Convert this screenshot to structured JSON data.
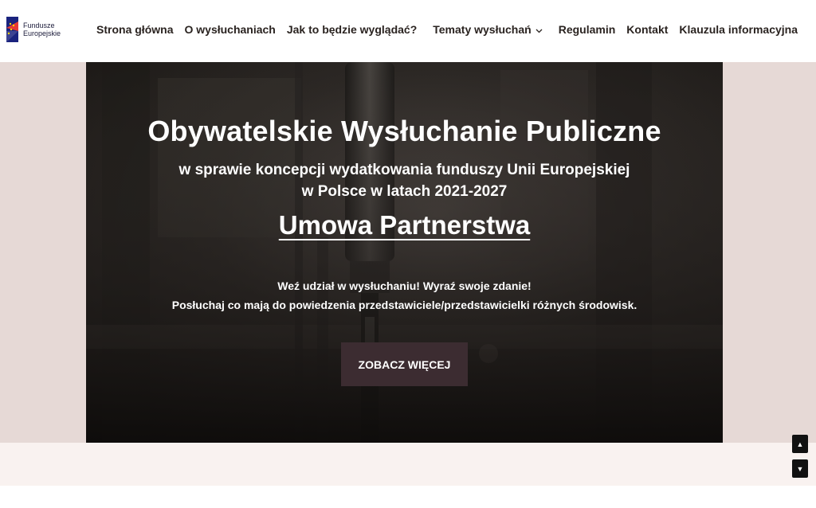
{
  "logo": {
    "line1": "Fundusze",
    "line2": "Europejskie"
  },
  "nav": {
    "items": [
      {
        "label": "Strona główna"
      },
      {
        "label": "O wysłuchaniach"
      },
      {
        "label": "Jak to będzie wyglądać?"
      },
      {
        "label": "Tematy wysłuchań"
      },
      {
        "label": "Regulamin"
      },
      {
        "label": "Kontakt"
      },
      {
        "label": "Klauzula informacyjna"
      }
    ]
  },
  "hero": {
    "title": "Obywatelskie Wysłuchanie Publiczne",
    "subtitle_line1": "w sprawie koncepcji wydatkowania funduszy Unii Europejskiej",
    "subtitle_line2": "w Polsce w latach 2021-2027",
    "heading": "Umowa Partnerstwa",
    "text_line1": "Weź udział w wysłuchaniu! Wyraź swoje zdanie!",
    "text_line2": "Posłuchaj co mają do powiedzenia przedstawiciele/przedstawicielki różnych środowisk.",
    "cta_label": "ZOBACZ WIĘCEJ"
  },
  "scroll": {
    "up_icon": "▲",
    "down_icon": "▼"
  },
  "colors": {
    "band": "#e6d9d6",
    "band_light": "#f9f2f0",
    "cta_bg": "#3c2c31",
    "nav_text": "#2a2320"
  }
}
